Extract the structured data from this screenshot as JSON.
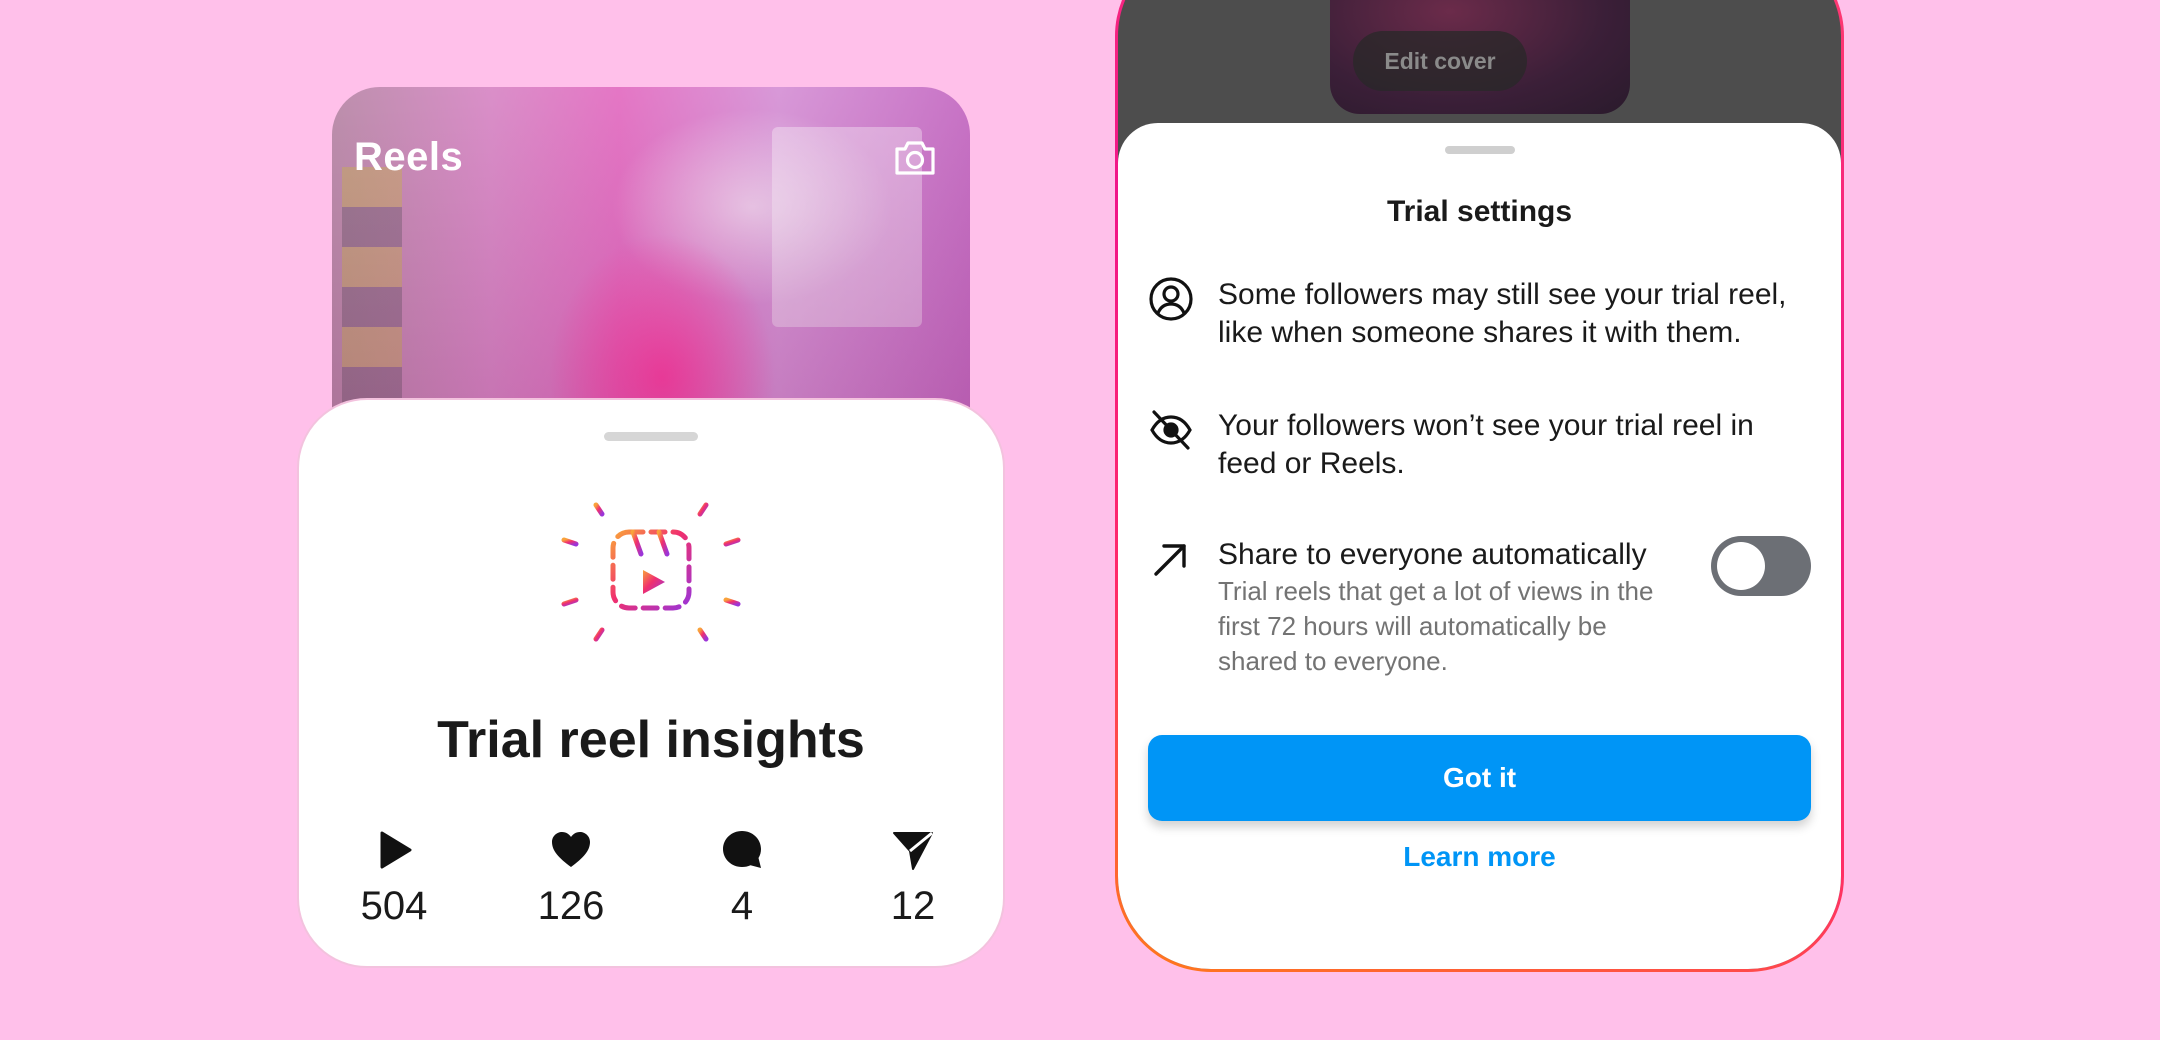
{
  "reel_card": {
    "title": "Reels",
    "camera_icon": "camera-icon",
    "insights_title": "Trial reel insights",
    "trial_icon": "trial-reels-icon",
    "stats": [
      {
        "icon": "play-icon",
        "value": "504"
      },
      {
        "icon": "heart-icon",
        "value": "126"
      },
      {
        "icon": "comment-icon",
        "value": "4"
      },
      {
        "icon": "share-icon",
        "value": "12"
      }
    ]
  },
  "phone": {
    "edit_cover_label": "Edit cover",
    "sheet": {
      "title": "Trial settings",
      "items": [
        {
          "icon": "user-circle-icon",
          "text": "Some followers may still see your trial reel, like when someone shares it with them."
        },
        {
          "icon": "eye-off-icon",
          "text": "Your followers won’t see your trial reel in feed or Reels."
        },
        {
          "icon": "arrow-up-right-icon",
          "text": "Share to everyone automatically",
          "subtext": "Trial reels that get a lot of views in the first 72 hours will automatically be shared to everyone.",
          "toggle_on": false
        }
      ],
      "primary_button": "Got it",
      "secondary_link": "Learn more"
    }
  },
  "colors": {
    "background": "#ffc0ea",
    "accent_blue": "#0095f6",
    "toggle_off": "#6c6f75"
  }
}
